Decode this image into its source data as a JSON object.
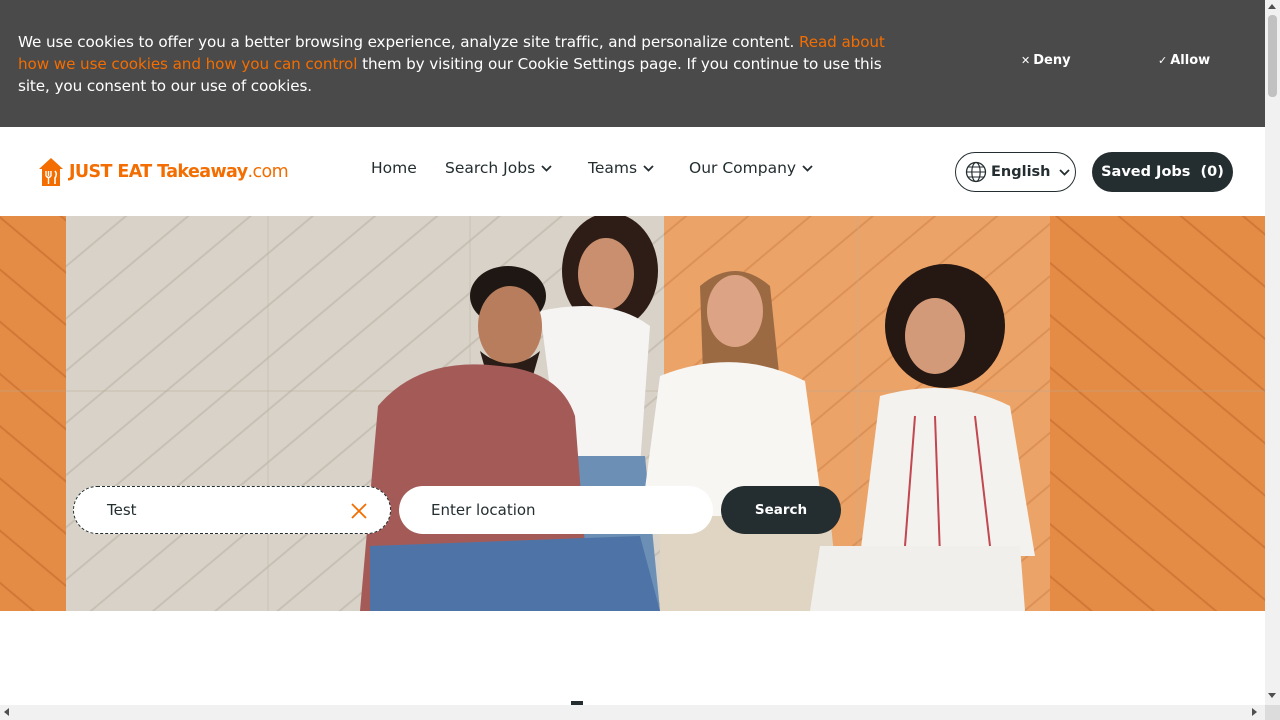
{
  "cookie_banner": {
    "text_before_link": "We use cookies to offer you a better browsing experience, analyze site traffic, and personalize content. ",
    "link_text": "Read about how we use cookies and how you can control",
    "text_after_link": " them by visiting our Cookie Settings page. If you continue to use this site, you consent to our use of cookies.",
    "deny_label": "Deny",
    "allow_label": "Allow",
    "deny_icon": "close-icon",
    "allow_icon": "check-icon"
  },
  "header": {
    "logo_text_main": "JUST EAT Takeaway",
    "logo_text_suffix": ".com",
    "nav": [
      {
        "label": "Home",
        "has_dropdown": false
      },
      {
        "label": "Search Jobs",
        "has_dropdown": true
      },
      {
        "label": "Teams",
        "has_dropdown": true
      },
      {
        "label": "Our Company",
        "has_dropdown": true
      }
    ],
    "language": "English",
    "saved_jobs_label": "Saved Jobs",
    "saved_jobs_count": "(0)"
  },
  "hero": {
    "keyword_value": "Test",
    "location_placeholder": "Enter location",
    "search_label": "Search"
  },
  "colors": {
    "brand_orange": "#f36d00",
    "dark": "#242e30",
    "banner_bg": "#4a4a4a"
  }
}
